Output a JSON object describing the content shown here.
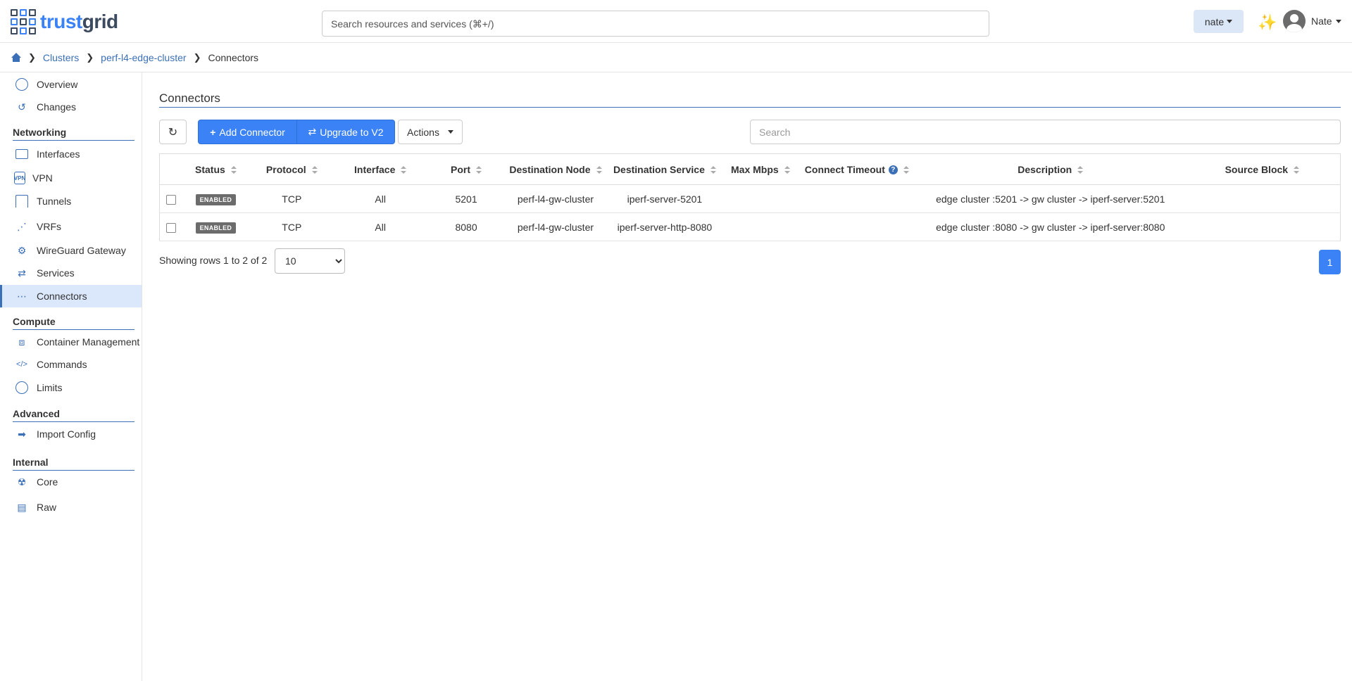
{
  "app": {
    "logo_part1": "trust",
    "logo_part2": "grid"
  },
  "topbar": {
    "search_placeholder": "Search resources and services (⌘+/)",
    "org_label": "nate",
    "user_name": "Nate"
  },
  "breadcrumb": {
    "items": [
      "Clusters",
      "perf-l4-edge-cluster"
    ],
    "current": "Connectors"
  },
  "sidebar": {
    "top_items": [
      "Overview",
      "Changes"
    ],
    "sections": [
      {
        "title": "Networking",
        "items": [
          "Interfaces",
          "VPN",
          "Tunnels",
          "VRFs",
          "WireGuard Gateway",
          "Services",
          "Connectors"
        ]
      },
      {
        "title": "Compute",
        "items": [
          "Container Management",
          "Commands",
          "Limits"
        ]
      },
      {
        "title": "Advanced",
        "items": [
          "Import Config"
        ]
      },
      {
        "title": "Internal",
        "items": [
          "Core",
          "Raw"
        ]
      }
    ],
    "vpn_icon_text": "VPN",
    "active_item": "Connectors"
  },
  "main": {
    "title": "Connectors",
    "add_label": "Add Connector",
    "upgrade_label": "Upgrade to V2",
    "actions_label": "Actions",
    "search_placeholder": "Search",
    "columns": [
      "Status",
      "Protocol",
      "Interface",
      "Port",
      "Destination Node",
      "Destination Service",
      "Max Mbps",
      "Connect Timeout",
      "Description",
      "Source Block"
    ],
    "rows": [
      {
        "status": "ENABLED",
        "protocol": "TCP",
        "interface": "All",
        "port": "5201",
        "destination_node": "perf-l4-gw-cluster",
        "destination_service": "iperf-server-5201",
        "max_mbps": "",
        "connect_timeout": "",
        "description": "edge cluster :5201 -> gw cluster -> iperf-server:5201",
        "source_block": ""
      },
      {
        "status": "ENABLED",
        "protocol": "TCP",
        "interface": "All",
        "port": "8080",
        "destination_node": "perf-l4-gw-cluster",
        "destination_service": "iperf-server-http-8080",
        "max_mbps": "",
        "connect_timeout": "",
        "description": "edge cluster :8080 -> gw cluster -> iperf-server:8080",
        "source_block": ""
      }
    ],
    "showing_text": "Showing rows 1 to 2 of 2",
    "page_size": "10",
    "page_size_options": [
      "10"
    ],
    "current_page": "1"
  },
  "colors": {
    "accent": "#3b82f6",
    "link": "#3b6fb6",
    "badge": "#6c6c6c"
  }
}
